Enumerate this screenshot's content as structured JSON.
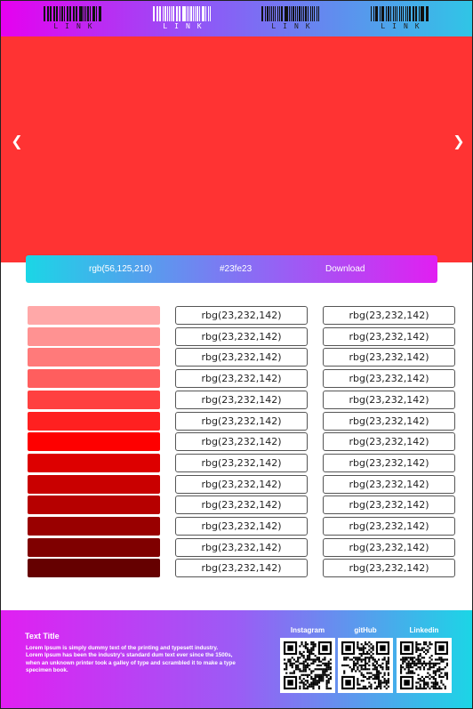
{
  "nav": {
    "links": [
      {
        "label": "LINK",
        "style": "dark"
      },
      {
        "label": "LINK",
        "style": "light"
      },
      {
        "label": "LINK",
        "style": "dark"
      },
      {
        "label": "LINK",
        "style": "dark"
      }
    ]
  },
  "hero": {
    "background": "#ff3333",
    "prev_icon": "chevron-left-icon",
    "next_icon": "chevron-right-icon"
  },
  "info_bar": {
    "rgb": "rgb(56,125,210)",
    "hex": "#23fe23",
    "download_label": "Download"
  },
  "palette": {
    "swatch_colors": [
      "#ffa8a8",
      "#ff9292",
      "#ff7a7a",
      "#ff5e5e",
      "#ff4040",
      "#ff2020",
      "#fe0000",
      "#dd0000",
      "#c90000",
      "#b60000",
      "#990000",
      "#7f0000",
      "#650000"
    ],
    "rows": [
      {
        "col1": "rbg(23,232,142)",
        "col2": "rbg(23,232,142)"
      },
      {
        "col1": "rbg(23,232,142)",
        "col2": "rbg(23,232,142)"
      },
      {
        "col1": "rbg(23,232,142)",
        "col2": "rbg(23,232,142)"
      },
      {
        "col1": "rbg(23,232,142)",
        "col2": "rbg(23,232,142)"
      },
      {
        "col1": "rbg(23,232,142)",
        "col2": "rbg(23,232,142)"
      },
      {
        "col1": "rbg(23,232,142)",
        "col2": "rbg(23,232,142)"
      },
      {
        "col1": "rbg(23,232,142)",
        "col2": "rbg(23,232,142)"
      },
      {
        "col1": "rbg(23,232,142)",
        "col2": "rbg(23,232,142)"
      },
      {
        "col1": "rbg(23,232,142)",
        "col2": "rbg(23,232,142)"
      },
      {
        "col1": "rbg(23,232,142)",
        "col2": "rbg(23,232,142)"
      },
      {
        "col1": "rbg(23,232,142)",
        "col2": "rbg(23,232,142)"
      },
      {
        "col1": "rbg(23,232,142)",
        "col2": "rbg(23,232,142)"
      },
      {
        "col1": "rbg(23,232,142)",
        "col2": "rbg(23,232,142)"
      }
    ]
  },
  "footer": {
    "title": "Text Title",
    "body": "Lorem Ipsum is simply dummy text of the printing and typesett industry. Lorem Ipsum has been the industry's standard dum text ever since the 1500s, when an unknown printer took a galley of type and scrambled it to make a type specimen book.",
    "social": [
      {
        "label": "Instagram",
        "icon": "qr-code-icon"
      },
      {
        "label": "gitHub",
        "icon": "qr-code-icon"
      },
      {
        "label": "Linkedin",
        "icon": "qr-code-icon"
      }
    ]
  },
  "colors": {
    "accent_magenta": "#e11ff2",
    "accent_cyan": "#1bd6e6",
    "hero_red": "#ff3333"
  }
}
